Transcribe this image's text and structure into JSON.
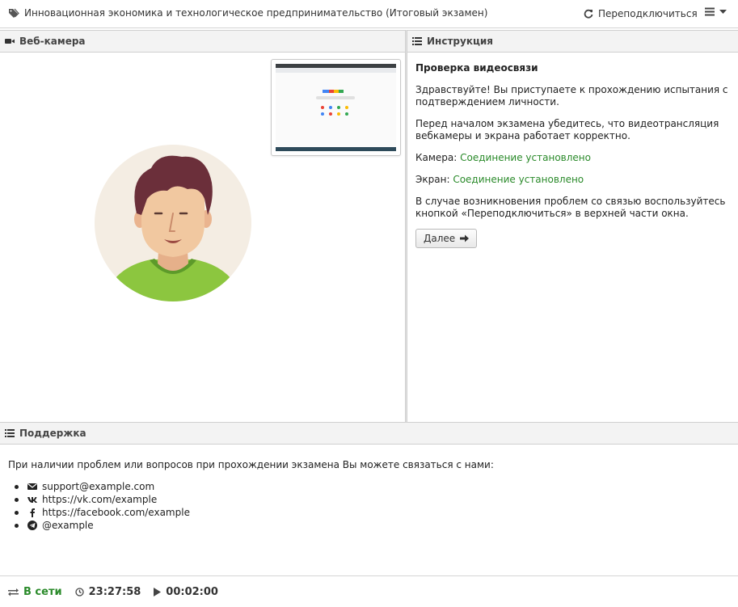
{
  "header": {
    "title": "Инновационная экономика и технологическое предпринимательство (Итоговый экзамен)",
    "reconnect_label": "Переподключиться"
  },
  "webcam": {
    "title": "Веб-камера"
  },
  "instructions": {
    "title": "Инструкция",
    "heading": "Проверка видеосвязи",
    "p1": "Здравствуйте! Вы приступаете к прохождению испытания с подтверждением личности.",
    "p2": "Перед началом экзамена убедитесь, что видеотрансляция вебкамеры и экрана работает корректно.",
    "camera_label": "Камера:",
    "camera_status": "Соединение установлено",
    "screen_label": "Экран:",
    "screen_status": "Соединение установлено",
    "p3": "В случае возникновения проблем со связью воспользуйтесь кнопкой «Переподключиться» в верхней части окна.",
    "next_label": "Далее"
  },
  "support": {
    "title": "Поддержка",
    "intro": "При наличии проблем или вопросов при прохождении экзамена Вы можете связаться с нами:",
    "contacts": [
      {
        "icon": "envelope-icon",
        "text": "support@example.com"
      },
      {
        "icon": "vk-icon",
        "text": "https://vk.com/example"
      },
      {
        "icon": "facebook-icon",
        "text": "https://facebook.com/example"
      },
      {
        "icon": "telegram-icon",
        "text": "@example"
      }
    ]
  },
  "status": {
    "connection": "В сети",
    "clock": "23:27:58",
    "elapsed": "00:02:00"
  },
  "colors": {
    "online": "#2a8a2a",
    "avatar_bg": "#f4ede3",
    "shirt": "#8cc63f",
    "hair": "#6b2f3a"
  }
}
